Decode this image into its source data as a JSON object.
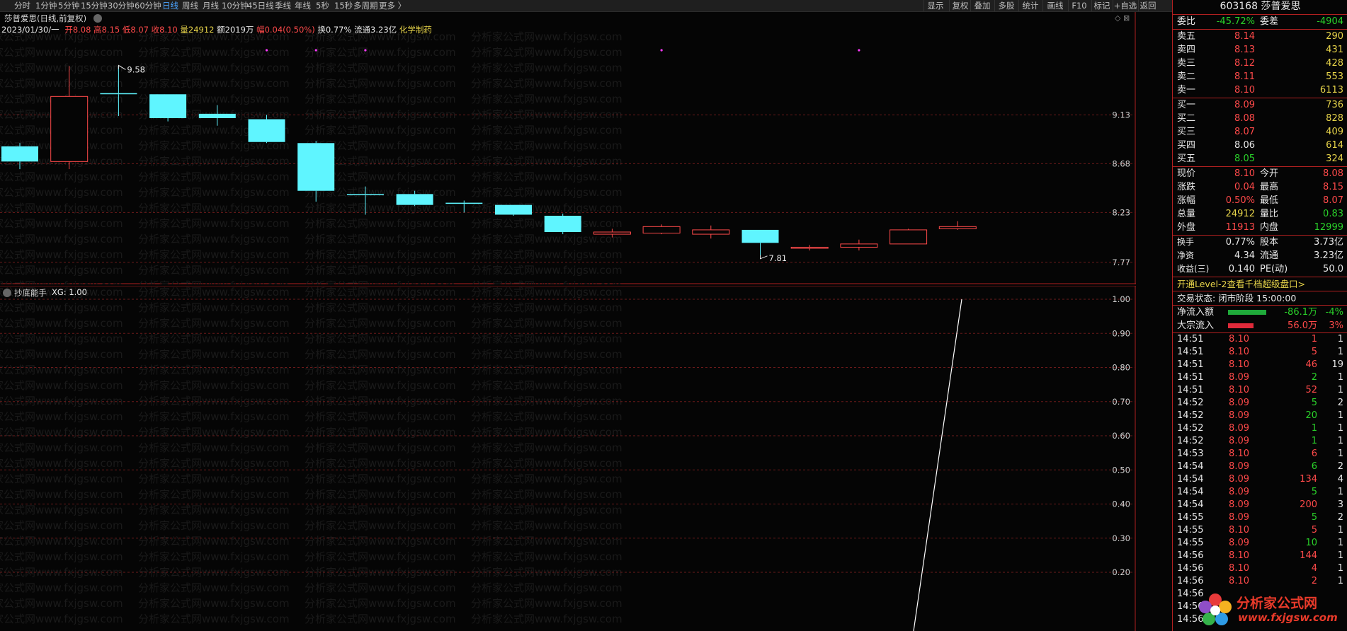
{
  "toolbar": {
    "tabs": [
      "分时",
      "1分钟",
      "5分钟",
      "15分钟",
      "30分钟",
      "60分钟",
      "日线",
      "周线",
      "月线",
      "10分钟",
      "45日线",
      "季线",
      "年线",
      "5秒",
      "15秒",
      "多周期",
      "更多 〉"
    ],
    "active_index": 6,
    "right_buttons": [
      "显示",
      "复权",
      "叠加",
      "多股",
      "统计",
      "画线",
      "F10",
      "标记",
      "+自选",
      "返回"
    ]
  },
  "main_chart": {
    "title": "莎普爱思(日线,前复权)",
    "info": {
      "date": "2023/01/30/一",
      "open": "开8.08",
      "high": "高8.15",
      "low": "低8.07",
      "close": "收8.10",
      "volume": "量24912",
      "amount": "额2019万",
      "change": "幅0.04(0.50%)",
      "turnover": "换0.77%",
      "float": "流通3.23亿",
      "sector": "化学制药"
    },
    "y_ticks": [
      "9.13",
      "8.68",
      "8.23",
      "7.77"
    ],
    "high_label": "9.58",
    "low_label": "7.81",
    "watermark": "分析家公式网www.fxjgsw.com"
  },
  "chart_data": {
    "type": "candlestick",
    "ylim": [
      7.6,
      9.85
    ],
    "y_ticks": [
      9.13,
      8.68,
      8.23,
      7.77
    ],
    "candles": [
      {
        "o": 8.7,
        "c": 8.84,
        "h": 8.87,
        "l": 8.63,
        "color": "cyan"
      },
      {
        "o": 8.7,
        "c": 9.3,
        "h": 9.58,
        "l": 8.63,
        "color": "red"
      },
      {
        "o": 9.33,
        "c": 9.33,
        "h": 9.58,
        "l": 9.12,
        "color": "cyan"
      },
      {
        "o": 9.32,
        "c": 9.1,
        "h": 9.32,
        "l": 9.07,
        "color": "cyan"
      },
      {
        "o": 9.14,
        "c": 9.1,
        "h": 9.22,
        "l": 9.03,
        "color": "cyan"
      },
      {
        "o": 9.09,
        "c": 8.88,
        "h": 9.13,
        "l": 8.87,
        "color": "cyan"
      },
      {
        "o": 8.87,
        "c": 8.43,
        "h": 8.89,
        "l": 8.33,
        "color": "cyan"
      },
      {
        "o": 8.4,
        "c": 8.4,
        "h": 8.47,
        "l": 8.21,
        "color": "cyan"
      },
      {
        "o": 8.4,
        "c": 8.3,
        "h": 8.43,
        "l": 8.29,
        "color": "cyan"
      },
      {
        "o": 8.32,
        "c": 8.31,
        "h": 8.34,
        "l": 8.23,
        "color": "cyan"
      },
      {
        "o": 8.3,
        "c": 8.21,
        "h": 8.3,
        "l": 8.2,
        "color": "cyan"
      },
      {
        "o": 8.2,
        "c": 8.05,
        "h": 8.22,
        "l": 8.03,
        "color": "cyan"
      },
      {
        "o": 8.03,
        "c": 8.05,
        "h": 8.08,
        "l": 8.0,
        "color": "red"
      },
      {
        "o": 8.04,
        "c": 8.1,
        "h": 8.12,
        "l": 8.03,
        "color": "red"
      },
      {
        "o": 8.03,
        "c": 8.07,
        "h": 8.11,
        "l": 7.99,
        "color": "red"
      },
      {
        "o": 8.07,
        "c": 7.95,
        "h": 8.07,
        "l": 7.81,
        "color": "cyan"
      },
      {
        "o": 7.9,
        "c": 7.91,
        "h": 7.93,
        "l": 7.88,
        "color": "red"
      },
      {
        "o": 7.91,
        "c": 7.94,
        "h": 7.98,
        "l": 7.88,
        "color": "red"
      },
      {
        "o": 7.94,
        "c": 8.07,
        "h": 8.08,
        "l": 7.94,
        "color": "red"
      },
      {
        "o": 8.08,
        "c": 8.1,
        "h": 8.15,
        "l": 8.07,
        "color": "red"
      }
    ],
    "marker_indices": [
      5,
      6,
      7,
      13,
      17
    ]
  },
  "indicator": {
    "title": "抄底能手",
    "value": "XG: 1.00",
    "y_ticks": [
      "1.00",
      "0.90",
      "0.80",
      "0.70",
      "0.60",
      "0.50",
      "0.40",
      "0.30",
      "0.20"
    ]
  },
  "right_panel": {
    "code": "603168",
    "name": "莎普爱思",
    "wei": {
      "l1": "委比",
      "v1": "-45.72%",
      "l2": "委差",
      "v2": "-4904"
    },
    "sell": [
      {
        "label": "卖五",
        "price": "8.14",
        "vol": "290"
      },
      {
        "label": "卖四",
        "price": "8.13",
        "vol": "431"
      },
      {
        "label": "卖三",
        "price": "8.12",
        "vol": "428"
      },
      {
        "label": "卖二",
        "price": "8.11",
        "vol": "553"
      },
      {
        "label": "卖一",
        "price": "8.10",
        "vol": "6113"
      }
    ],
    "buy": [
      {
        "label": "买一",
        "price": "8.09",
        "vol": "736"
      },
      {
        "label": "买二",
        "price": "8.08",
        "vol": "828"
      },
      {
        "label": "买三",
        "price": "8.07",
        "vol": "409"
      },
      {
        "label": "买四",
        "price": "8.06",
        "vol": "614"
      },
      {
        "label": "买五",
        "price": "8.05",
        "vol": "324"
      }
    ],
    "quote": [
      {
        "l1": "现价",
        "v1": "8.10",
        "l2": "今开",
        "v2": "8.08"
      },
      {
        "l1": "涨跌",
        "v1": "0.04",
        "l2": "最高",
        "v2": "8.15"
      },
      {
        "l1": "涨幅",
        "v1": "0.50%",
        "l2": "最低",
        "v2": "8.07"
      },
      {
        "l1": "总量",
        "v1": "24912",
        "l2": "量比",
        "v2": "0.83"
      },
      {
        "l1": "外盘",
        "v1": "11913",
        "l2": "内盘",
        "v2": "12999"
      }
    ],
    "stats": [
      {
        "l1": "换手",
        "v1": "0.77%",
        "l2": "股本",
        "v2": "3.73亿"
      },
      {
        "l1": "净资",
        "v1": "4.34",
        "l2": "流通",
        "v2": "3.23亿"
      },
      {
        "l1": "收益(三)",
        "v1": "0.140",
        "l2": "PE(动)",
        "v2": "50.0"
      }
    ],
    "level2_link": "开通Level-2查看千档超级盘口>",
    "trade_status": "交易状态: 闭市阶段 15:00:00",
    "net_inflow": {
      "label": "净流入额",
      "value": "-86.1万",
      "pct": "-4%"
    },
    "big_inflow": {
      "label": "大宗流入",
      "value": "56.0万",
      "pct": "3%"
    },
    "ticks": [
      {
        "time": "14:51",
        "price": "8.10",
        "vol": "1",
        "n": "1"
      },
      {
        "time": "14:51",
        "price": "8.10",
        "vol": "5",
        "n": "1"
      },
      {
        "time": "14:51",
        "price": "8.10",
        "vol": "46",
        "n": "19"
      },
      {
        "time": "14:51",
        "price": "8.09",
        "vol": "2",
        "n": "1"
      },
      {
        "time": "14:51",
        "price": "8.10",
        "vol": "52",
        "n": "1"
      },
      {
        "time": "14:52",
        "price": "8.09",
        "vol": "5",
        "n": "2"
      },
      {
        "time": "14:52",
        "price": "8.09",
        "vol": "20",
        "n": "1"
      },
      {
        "time": "14:52",
        "price": "8.09",
        "vol": "1",
        "n": "1"
      },
      {
        "time": "14:52",
        "price": "8.09",
        "vol": "1",
        "n": "1"
      },
      {
        "time": "14:53",
        "price": "8.10",
        "vol": "6",
        "n": "1"
      },
      {
        "time": "14:54",
        "price": "8.09",
        "vol": "6",
        "n": "2"
      },
      {
        "time": "14:54",
        "price": "8.09",
        "vol": "134",
        "n": "4"
      },
      {
        "time": "14:54",
        "price": "8.09",
        "vol": "5",
        "n": "1"
      },
      {
        "time": "14:54",
        "price": "8.09",
        "vol": "200",
        "n": "3"
      },
      {
        "time": "14:55",
        "price": "8.09",
        "vol": "5",
        "n": "2"
      },
      {
        "time": "14:55",
        "price": "8.10",
        "vol": "5",
        "n": "1"
      },
      {
        "time": "14:55",
        "price": "8.09",
        "vol": "10",
        "n": "1"
      },
      {
        "time": "14:56",
        "price": "8.10",
        "vol": "144",
        "n": "1"
      },
      {
        "time": "14:56",
        "price": "8.10",
        "vol": "4",
        "n": "1"
      },
      {
        "time": "14:56",
        "price": "8.10",
        "vol": "2",
        "n": "1"
      },
      {
        "time": "14:56",
        "price": "",
        "vol": "",
        "n": ""
      },
      {
        "time": "14:56",
        "price": "",
        "vol": "",
        "n": ""
      },
      {
        "time": "14:56",
        "price": "",
        "vol": "",
        "n": ""
      }
    ],
    "logo_text": "分析家公式网",
    "logo_url": "www.fxjgsw.com"
  }
}
